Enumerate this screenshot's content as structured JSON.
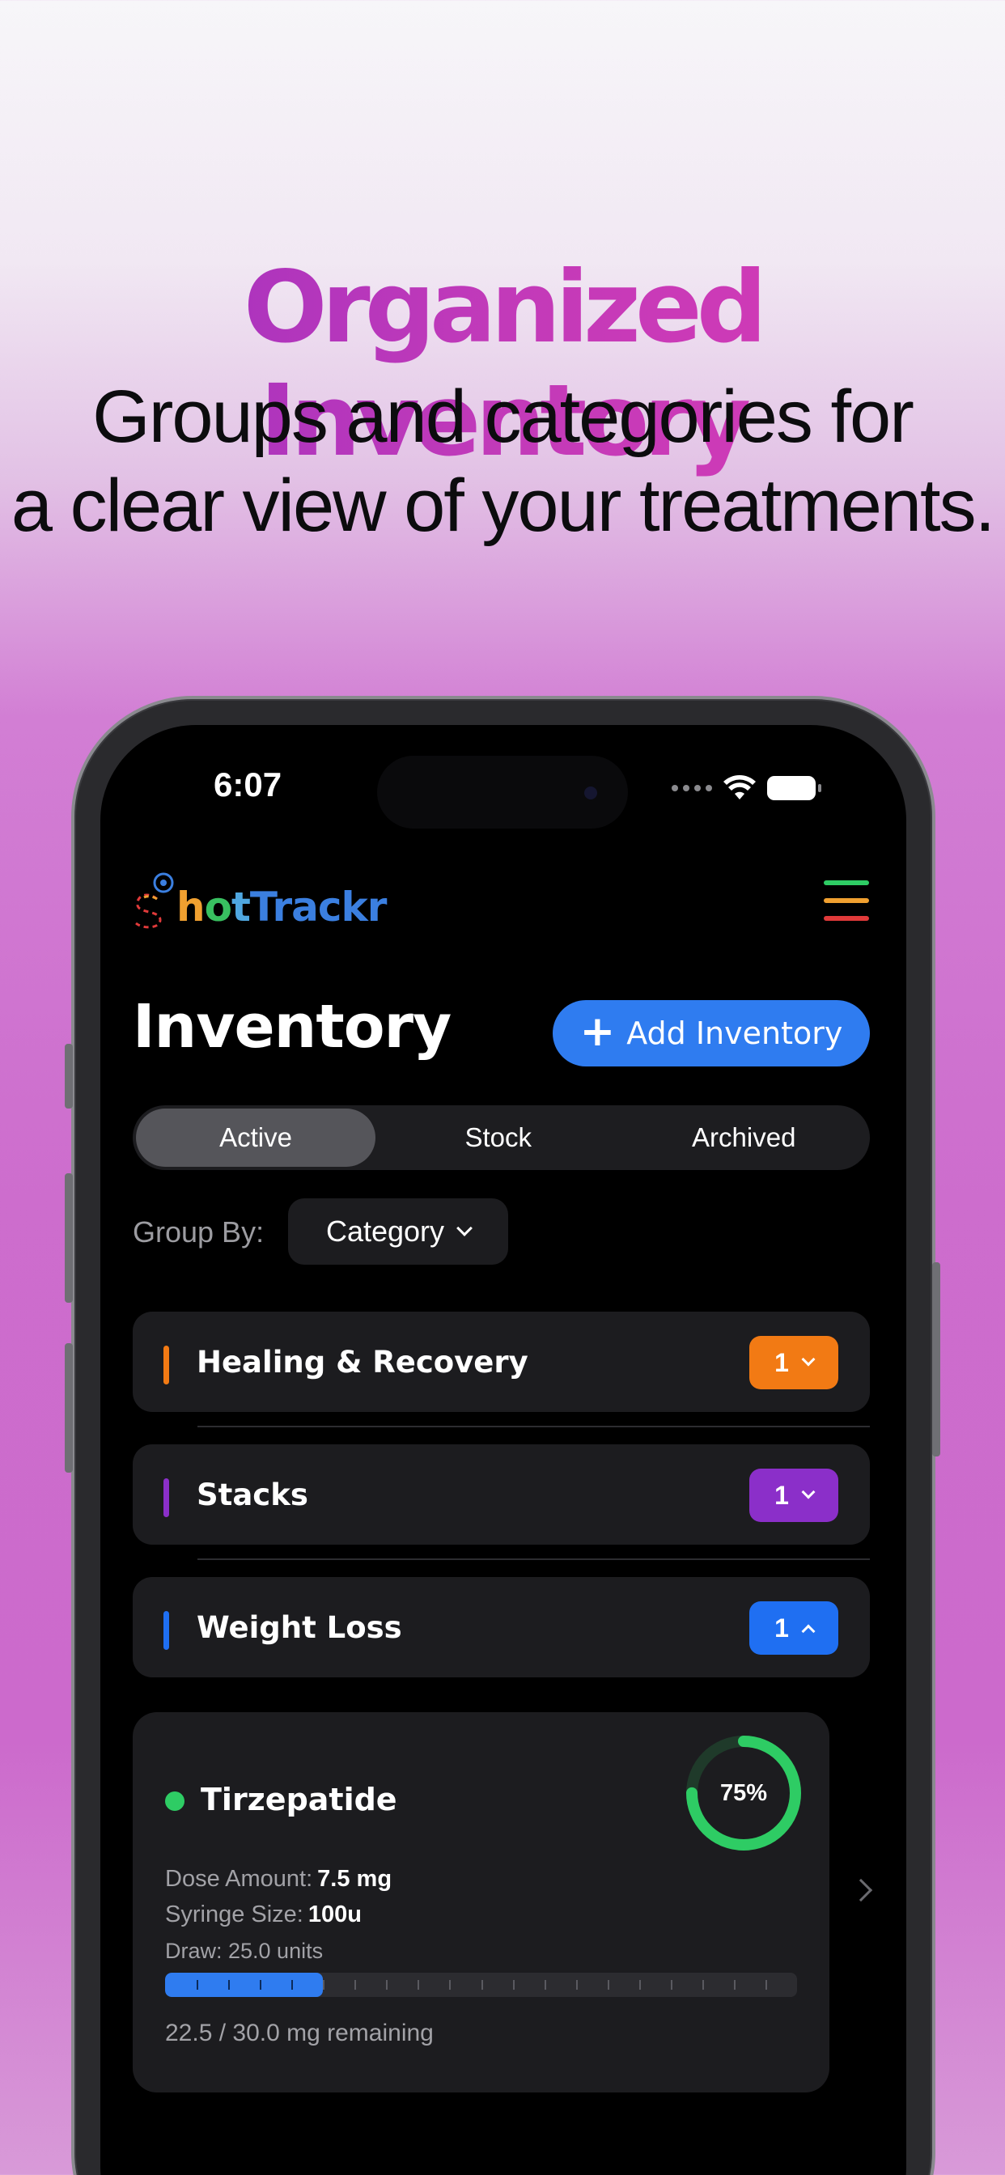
{
  "promo": {
    "headline": "Organized Inventory",
    "sub_line1": "Groups and categories for",
    "sub_line2": "a clear view of your treatments."
  },
  "status_bar": {
    "time": "6:07",
    "icons": [
      "cellular-dots-icon",
      "wifi-icon",
      "battery-icon"
    ]
  },
  "app": {
    "logo": {
      "h": "h",
      "o": "o",
      "t": "t",
      "rest": "Trackr"
    },
    "menu_icon": "hamburger-menu-icon",
    "colors": {
      "accent": "#2f7cf0",
      "menu_lines": [
        "#2ecc64",
        "#f0a030",
        "#e03a3a"
      ]
    }
  },
  "header": {
    "title": "Inventory",
    "add_button_icon": "plus-icon",
    "add_button_label": "Add Inventory"
  },
  "tabs": [
    {
      "label": "Active",
      "selected": true
    },
    {
      "label": "Stock",
      "selected": false
    },
    {
      "label": "Archived",
      "selected": false
    }
  ],
  "group_by": {
    "label": "Group By:",
    "value": "Category"
  },
  "categories": [
    {
      "name": "Healing & Recovery",
      "count": "1",
      "color": "#f27a14",
      "expanded": false
    },
    {
      "name": "Stacks",
      "count": "1",
      "color": "#8b2fc9",
      "expanded": false
    },
    {
      "name": "Weight Loss",
      "count": "1",
      "color": "#1f6ff2",
      "expanded": true
    }
  ],
  "item": {
    "name": "Tirzepatide",
    "status_color": "#2ecc64",
    "progress_label": "75%",
    "progress_fraction": 0.75,
    "dose_label": "Dose Amount:",
    "dose_value": "7.5 mg",
    "syringe_label": "Syringe Size:",
    "syringe_value": "100u",
    "draw_label": "Draw: 25.0 units",
    "draw_fraction": 0.25,
    "remaining": "22.5 / 30.0 mg remaining"
  }
}
